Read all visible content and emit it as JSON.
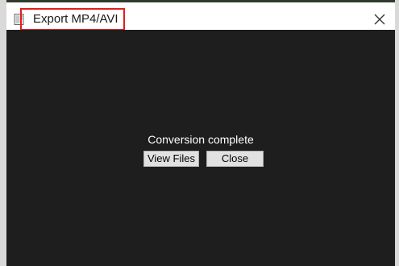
{
  "window": {
    "title": "Export MP4/AVI",
    "app_icon": "document-icon",
    "close_icon": "close-icon"
  },
  "dialog": {
    "message": "Conversion complete",
    "view_files_label": "View Files",
    "close_label": "Close"
  },
  "colors": {
    "content_background": "#1e1e1e",
    "title_highlight": "#e41c1c",
    "button_face": "#e1e1e1"
  }
}
